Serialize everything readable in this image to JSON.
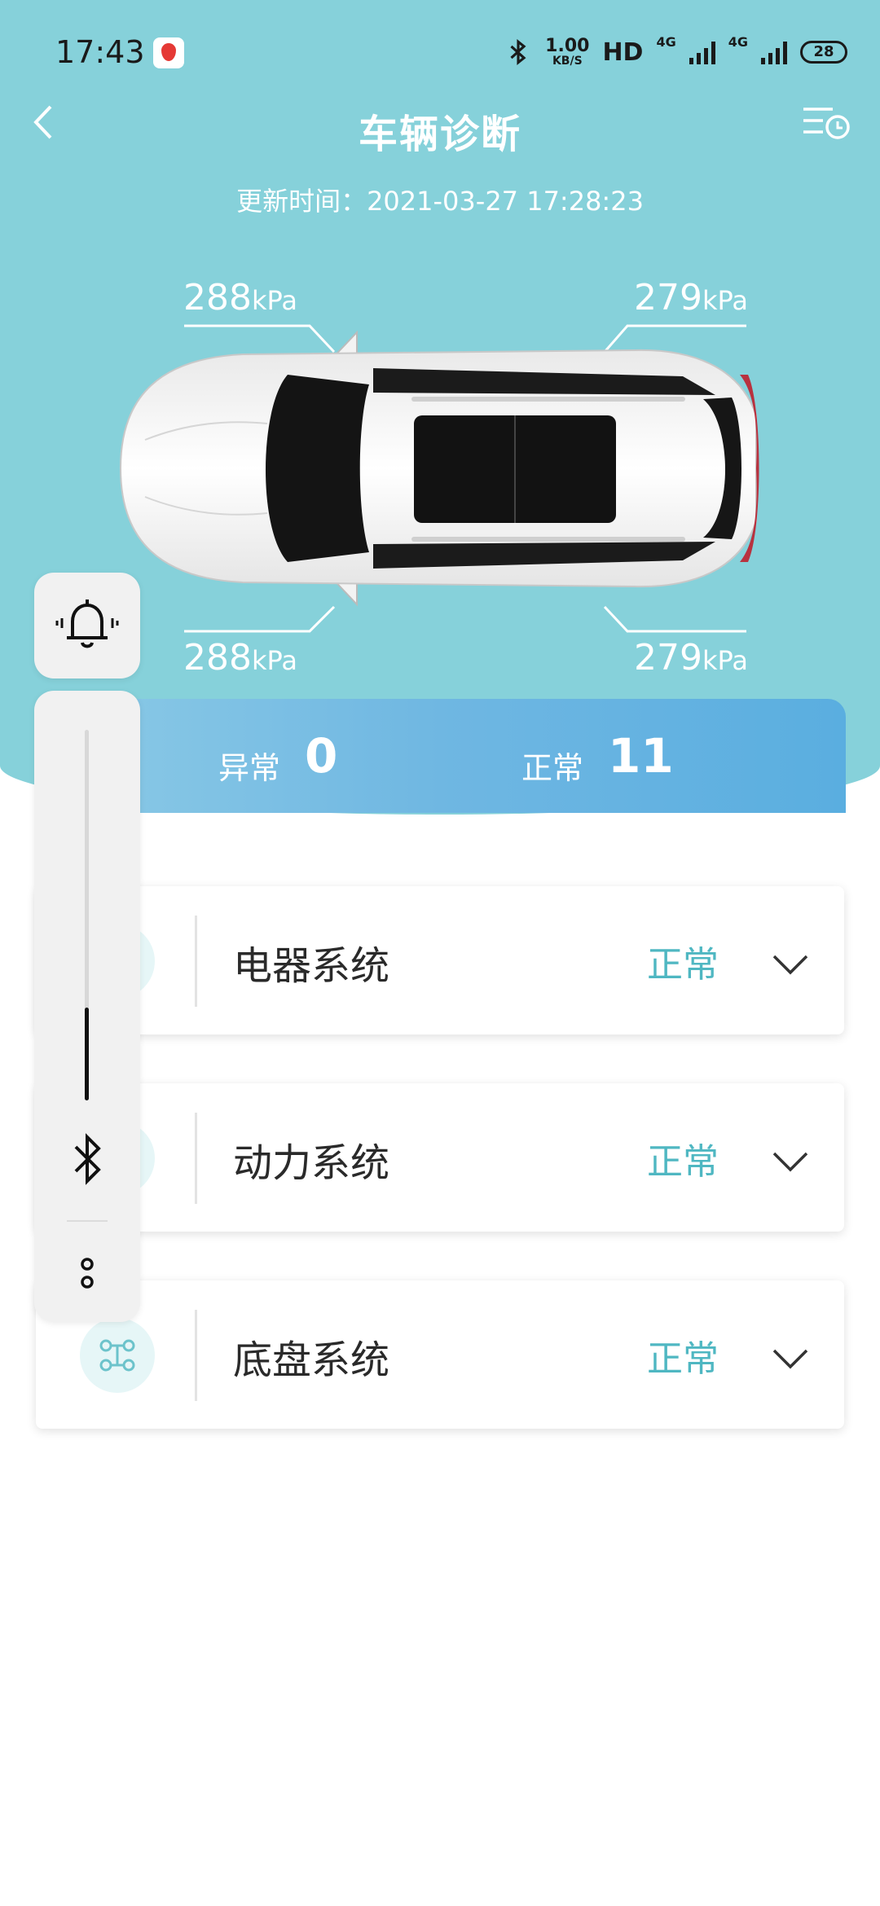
{
  "status_bar": {
    "time": "17:43",
    "speed_value": "1.00",
    "speed_unit": "KB/S",
    "hd": "HD",
    "network1": "4G",
    "network2": "4G",
    "battery": "28"
  },
  "header": {
    "title": "车辆诊断",
    "update_time": "更新时间：2021-03-27 17:28:23"
  },
  "tire_pressure": {
    "unit": "kPa",
    "front_left": "288",
    "front_right": "279",
    "rear_left": "288",
    "rear_right": "279"
  },
  "summary": {
    "abnormal_label": "异常",
    "abnormal_count": "0",
    "normal_label": "正常",
    "normal_count": "11"
  },
  "systems": [
    {
      "name": "电器系统",
      "status": "正常",
      "icon": "electrical-icon"
    },
    {
      "name": "动力系统",
      "status": "正常",
      "icon": "engine-icon"
    },
    {
      "name": "底盘系统",
      "status": "正常",
      "icon": "chassis-icon"
    }
  ],
  "floating_panel": {
    "volume_level": 0.25
  },
  "colors": {
    "header_bg": "#86d1da",
    "status_ok": "#4fb7c2",
    "summary_gradient_end": "#5aaee0"
  }
}
